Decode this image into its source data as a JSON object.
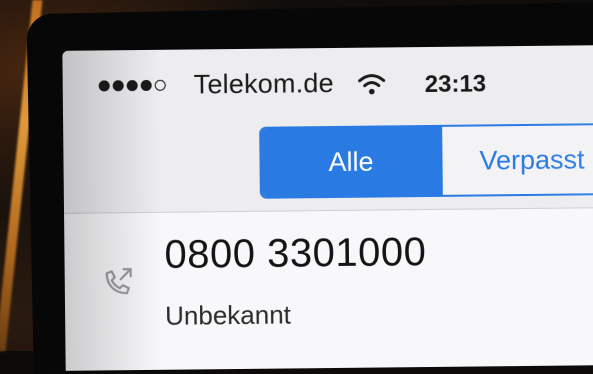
{
  "status_bar": {
    "signal_strength": {
      "filled": 4,
      "total": 5
    },
    "carrier": "Telekom.de",
    "wifi_icon": "wifi-icon",
    "time": "23:13"
  },
  "segmented_control": {
    "segments": [
      {
        "label": "Alle",
        "selected": true
      },
      {
        "label": "Verpasst",
        "selected": false
      }
    ]
  },
  "recent_call": {
    "number": "0800 3301000",
    "label": "Unbekannt",
    "icon": "outgoing-call-icon"
  },
  "colors": {
    "accent": "#2a7ae3",
    "frame_edge": "#e09a3a"
  }
}
